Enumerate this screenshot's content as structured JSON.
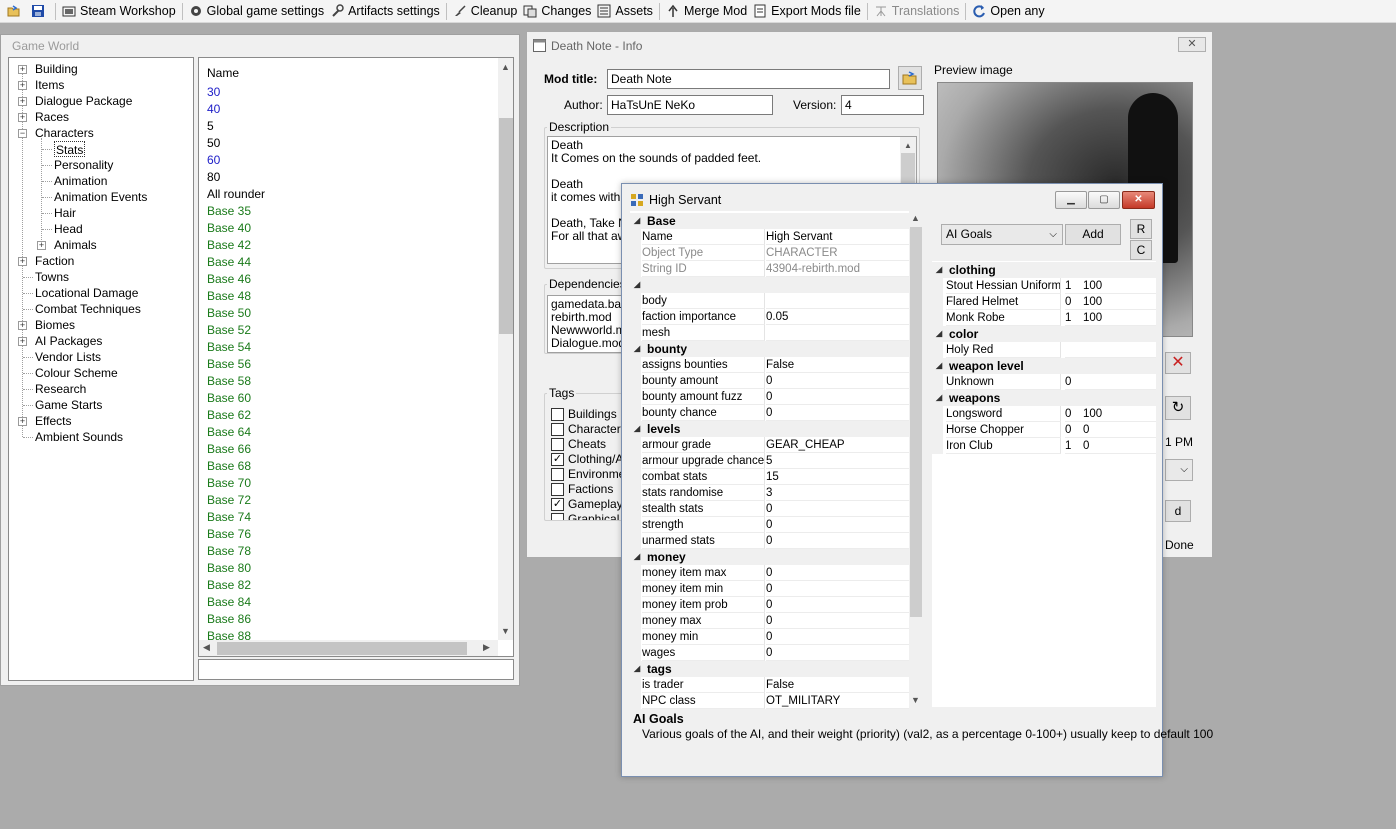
{
  "toolbar": {
    "items": [
      "Steam Workshop",
      "Global game settings",
      "Artifacts settings",
      "Cleanup",
      "Changes",
      "Assets",
      "Merge Mod",
      "Export Mods file",
      "Translations",
      "Open any"
    ]
  },
  "game_world": {
    "title": "Game World",
    "tree": [
      "Building",
      "Items",
      "Dialogue Package",
      "Races",
      "Characters",
      "Stats",
      "Personality",
      "Animation",
      "Animation Events",
      "Hair",
      "Head",
      "Animals",
      "Faction",
      "Towns",
      "Locational Damage",
      "Combat Techniques",
      "Biomes",
      "AI Packages",
      "Vendor Lists",
      "Colour Scheme",
      "Research",
      "Game Starts",
      "Effects",
      "Ambient Sounds"
    ],
    "list_header": "Name",
    "list_items": [
      "30",
      "40",
      "5",
      "50",
      "60",
      "80",
      "All rounder",
      "Base 35",
      "Base 40",
      "Base 42",
      "Base 44",
      "Base 46",
      "Base 48",
      "Base 50",
      "Base 52",
      "Base 54",
      "Base 56",
      "Base 58",
      "Base 60",
      "Base 62",
      "Base 64",
      "Base 66",
      "Base 68",
      "Base 70",
      "Base 72",
      "Base 74",
      "Base 76",
      "Base 78",
      "Base 80",
      "Base 82",
      "Base 84",
      "Base 86",
      "Base 88"
    ],
    "list_colors": [
      "#2020c8",
      "#2020c8",
      "#000000",
      "#000000",
      "#2020c8",
      "#000000",
      "#000000",
      "#1a7a1a"
    ]
  },
  "mod_info": {
    "title": "Death Note - Info",
    "mod_title_label": "Mod title:",
    "mod_title_value": "Death Note",
    "author_label": "Author:",
    "author_value": "HaTsUnE NeKo",
    "version_label": "Version:",
    "version_value": "4",
    "preview_label": "Preview image",
    "description_label": "Description",
    "description_lines": [
      "Death",
      "It Comes on the sounds of padded feet.",
      "",
      "Death",
      "it comes with th",
      "",
      "Death, Take N",
      "For all that awa"
    ],
    "dependencies_label": "Dependencies",
    "dependencies": [
      "gamedata.base",
      "rebirth.mod",
      "Newwworld.mo",
      "Dialogue.mod"
    ],
    "tags_label": "Tags",
    "tags": [
      {
        "label": "Buildings",
        "checked": false
      },
      {
        "label": "Characters",
        "checked": false
      },
      {
        "label": "Cheats",
        "checked": false
      },
      {
        "label": "Clothing/Ar",
        "checked": true
      },
      {
        "label": "Environmen",
        "checked": false
      },
      {
        "label": "Factions",
        "checked": false
      },
      {
        "label": "Gameplay",
        "checked": true
      },
      {
        "label": "Graphical",
        "checked": false
      }
    ],
    "time_fragment": "1 PM",
    "button_fragment": "d",
    "done_label": "Done"
  },
  "servant": {
    "title": "High Servant",
    "goals_combo": "AI Goals",
    "add_label": "Add",
    "r_label": "R",
    "c_label": "C",
    "sections": [
      {
        "name": "Base",
        "rows": [
          {
            "k": "Name",
            "v": "High Servant",
            "ro": false
          },
          {
            "k": "Object Type",
            "v": "CHARACTER",
            "ro": true
          },
          {
            "k": "String ID",
            "v": "43904-rebirth.mod",
            "ro": true
          }
        ]
      },
      {
        "name": "",
        "rows": [
          {
            "k": "body",
            "v": "",
            "ro": false
          },
          {
            "k": "faction importance",
            "v": "0.05",
            "ro": false
          },
          {
            "k": "mesh",
            "v": "",
            "ro": false
          }
        ]
      },
      {
        "name": "bounty",
        "rows": [
          {
            "k": "assigns bounties",
            "v": "False",
            "ro": false
          },
          {
            "k": "bounty amount",
            "v": "0",
            "ro": false
          },
          {
            "k": "bounty amount fuzz",
            "v": "0",
            "ro": false
          },
          {
            "k": "bounty chance",
            "v": "0",
            "ro": false
          }
        ]
      },
      {
        "name": "levels",
        "rows": [
          {
            "k": "armour grade",
            "v": "GEAR_CHEAP",
            "ro": false
          },
          {
            "k": "armour upgrade chance",
            "v": "5",
            "ro": false
          },
          {
            "k": "combat stats",
            "v": "15",
            "ro": false
          },
          {
            "k": "stats randomise",
            "v": "3",
            "ro": false
          },
          {
            "k": "stealth stats",
            "v": "0",
            "ro": false
          },
          {
            "k": "strength",
            "v": "0",
            "ro": false
          },
          {
            "k": "unarmed stats",
            "v": "0",
            "ro": false
          }
        ]
      },
      {
        "name": "money",
        "rows": [
          {
            "k": "money item max",
            "v": "0",
            "ro": false
          },
          {
            "k": "money item min",
            "v": "0",
            "ro": false
          },
          {
            "k": "money item prob",
            "v": "0",
            "ro": false
          },
          {
            "k": "money max",
            "v": "0",
            "ro": false
          },
          {
            "k": "money min",
            "v": "0",
            "ro": false
          },
          {
            "k": "wages",
            "v": "0",
            "ro": false
          }
        ]
      },
      {
        "name": "tags",
        "rows": [
          {
            "k": "is trader",
            "v": "False",
            "ro": false
          },
          {
            "k": "NPC class",
            "v": "OT_MILITARY",
            "ro": false
          }
        ]
      }
    ],
    "goals": [
      {
        "name": "clothing",
        "rows": [
          {
            "k": "Stout Hessian Uniform",
            "v1": "1",
            "v2": "100"
          },
          {
            "k": "Flared Helmet",
            "v1": "0",
            "v2": "100"
          },
          {
            "k": "Monk Robe",
            "v1": "1",
            "v2": "100"
          }
        ]
      },
      {
        "name": "color",
        "rows": [
          {
            "k": "Holy Red",
            "v1": "",
            "v2": ""
          }
        ]
      },
      {
        "name": "weapon level",
        "rows": [
          {
            "k": "Unknown",
            "v1": "0",
            "v2": ""
          }
        ]
      },
      {
        "name": "weapons",
        "rows": [
          {
            "k": "Longsword",
            "v1": "0",
            "v2": "100"
          },
          {
            "k": "Horse Chopper",
            "v1": "0",
            "v2": "0"
          },
          {
            "k": "Iron Club",
            "v1": "1",
            "v2": "0"
          }
        ]
      }
    ],
    "desc_title": "AI Goals",
    "desc_text": "Various goals of the AI, and their weight (priority) (val2, as a percentage 0-100+) usually keep to default 100"
  }
}
